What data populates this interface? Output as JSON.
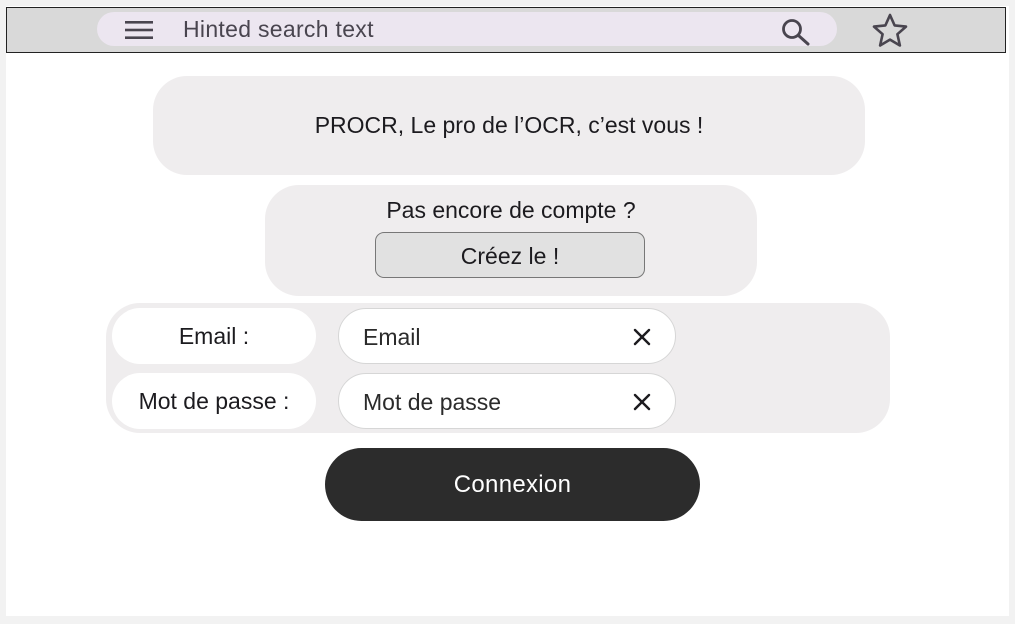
{
  "app": {
    "search": {
      "hint": "Hinted search text",
      "menu_icon": "hamburger-menu-icon",
      "search_icon": "magnifier-icon",
      "favorite_icon": "star-outline-icon"
    }
  },
  "main": {
    "banner": "PROCR, Le pro de l’OCR, c’est vous !",
    "signup": {
      "prompt": "Pas encore de compte ?",
      "button_label": "Créez le !"
    },
    "form": {
      "email_label": "Email :",
      "email_value": "Email",
      "password_label": "Mot de passe :",
      "password_value": "Mot de passe",
      "clear_icon": "close-x-icon"
    },
    "submit_label": "Connexion"
  },
  "colors": {
    "toolbar": "#d9d9d9",
    "searchbar": "#ece6f0",
    "card": "#efedee",
    "primary_button": "#2c2c2c"
  }
}
